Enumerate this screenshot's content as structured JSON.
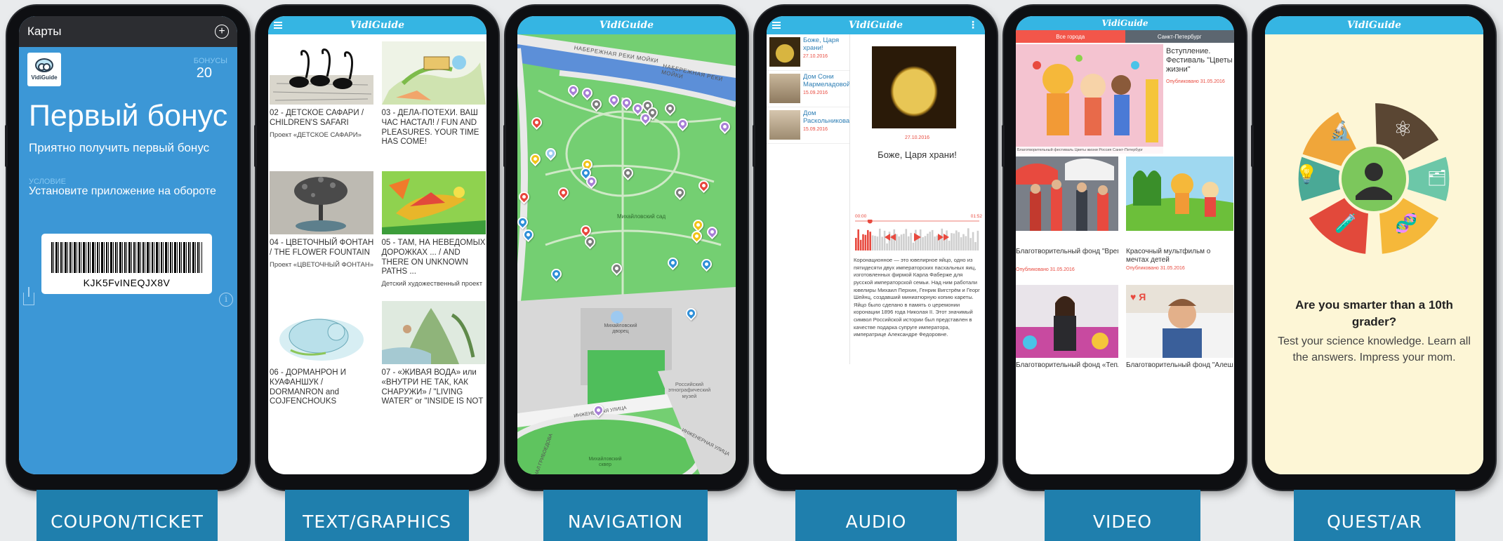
{
  "coupon": {
    "top_title": "Карты",
    "logo_text": "VidiGuide",
    "bonus_label": "БОНУСЫ",
    "bonus_value": "20",
    "title": "Первый бонус",
    "subtitle": "Приятно получить первый бонус",
    "condition_label": "УСЛОВИЕ",
    "condition_value": "Установите приложение на обороте",
    "barcode_value": "KJK5FvINEQJX8V"
  },
  "app_title": "VidiGuide",
  "text_graphics": {
    "items": [
      {
        "title": "02 - ДЕТСКОЕ САФАРИ / CHILDREN'S SAFARI",
        "subtitle": "Проект «ДЕТСКОЕ САФАРИ»"
      },
      {
        "title": "03 - ДЕЛА-ПОТЕХИ. ВАШ ЧАС НАСТАЛ! / FUN AND PLEASURES. YOUR TIME HAS COME!",
        "subtitle": ""
      },
      {
        "title": "04 - ЦВЕТОЧНЫЙ ФОНТАН / THE FLOWER FOUNTAIN",
        "subtitle": "Проект «ЦВЕТОЧНЫЙ ФОНТАН»"
      },
      {
        "title": "05 - ТАМ, НА НЕВЕДОМЫХ ДОРОЖКАХ ... / AND THERE ON UNKNOWN PATHS ...",
        "subtitle": "Детский художественный проект"
      },
      {
        "title": "06 - ДОРМАНРОН И КУАФАНШУК / DORMANRON and COJFENCHOUKS",
        "subtitle": ""
      },
      {
        "title": "07 - «ЖИВАЯ ВОДА» или «ВНУТРИ НЕ ТАК, КАК СНАРУЖИ» / \"LIVING WATER\" or \"INSIDE IS NOT",
        "subtitle": ""
      }
    ]
  },
  "map": {
    "labels": {
      "embankment_1": "НАБЕРЕЖНАЯ РЕКИ МОЙКИ",
      "embankment_2": "НАБЕРЕЖНАЯ РЕКИ МОЙКИ",
      "garden": "Михайловский сад",
      "palace": "Михайловский дворец",
      "museum": "Российский этнографический музей",
      "street_1": "ИНЖЕНЕРНАЯ УЛИЦА",
      "street_2": "ИНЖЕНЕРНАЯ УЛИЦА",
      "square": "Михайловский сквер",
      "street_side": "КАНАЛ ГРИБОЕДОВА"
    }
  },
  "audio": {
    "items": [
      {
        "title": "Боже, Царя храни!",
        "date": "27.10.2016"
      },
      {
        "title": "Дом Сони Мармеладовой",
        "date": "15.09.2016"
      },
      {
        "title": "Дом Раскольникова",
        "date": "15.09.2016"
      }
    ],
    "detail": {
      "date": "27.10.2016",
      "title": "Боже, Царя храни!",
      "time_start": "00:00",
      "time_end": "01:52",
      "body": "Коронационное — это ювелирное яйцо, одно из пятидесяти двух императорских пасхальных яиц, изготовленных фирмой Карла Фаберже для русской императорской семьи. Над ним работали ювелиры Михаил Перхин, Генрик Вигстрём и Георг Шейнц, создавший миниатюрную копию кареты. Яйцо было сделано в память о церемонии коронации 1896 года Николая II. Этот значимый символ Российской истории был представлен в качестве подарка супруге императора, императрице Александре Федоровне."
    },
    "progress": 0.12
  },
  "video": {
    "tabs": [
      "Все города",
      "Санкт-Петербург"
    ],
    "featured": {
      "title": "Вступление. Фестиваль \"Цветы жизни\"",
      "date": "Опубликовано 31.05.2016",
      "caption": "Благотворительный фестиваль Цветы жизни Россия Санкт-Петербург"
    },
    "items": [
      {
        "title": "Благотворительный фонд \"Время жить\"",
        "date": "Опубликовано 31.05.2016"
      },
      {
        "title": "Красочный мультфильм о мечтах детей",
        "date": "Опубликовано 31.05.2016"
      },
      {
        "title": "Благотворительный фонд «Теплый",
        "date": ""
      },
      {
        "title": "Благотворительный фонд \"Алеша",
        "date": ""
      }
    ]
  },
  "quest": {
    "heading": "Are you smarter than a 10th grader?",
    "text": "Test your science knowledge. Learn all the answers. Impress your mom."
  },
  "tabs": [
    "COUPON/TICKET",
    "TEXT/GRAPHICS",
    "NAVIGATION",
    "AUDIO",
    "VIDEO",
    "QUEST/AR"
  ],
  "colors": {
    "label_bg": "#1f7fad",
    "header_blue": "#35b5e3",
    "coupon_blue": "#3c97d6",
    "map_green": "#6fcd6f",
    "pin_red": "#e8463d",
    "pin_gray": "#7d7d7d",
    "pin_blue": "#2f8fd8",
    "pin_yellow": "#f2c418",
    "pin_purple": "#a77fd6",
    "video_tab_active": "#f2564a",
    "video_tab_inactive": "#5c6670",
    "quest_bg": "#fdf6d6"
  }
}
